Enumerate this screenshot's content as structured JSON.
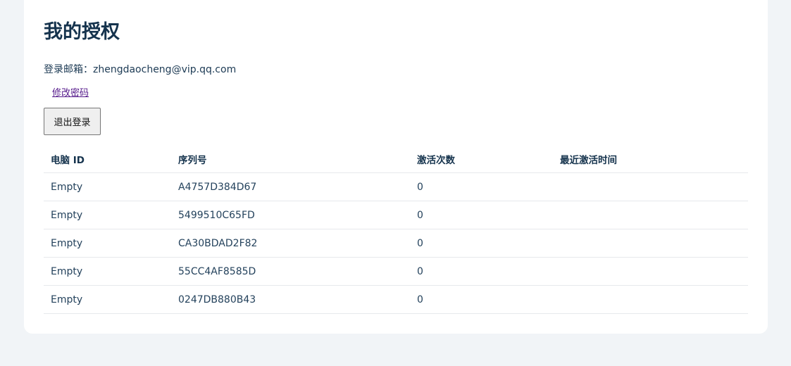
{
  "page": {
    "title": "我的授权",
    "email_label": "登录邮箱：",
    "email_value": "zhengdaocheng@vip.qq.com",
    "change_password_link": "修改密码",
    "logout_button": "退出登录"
  },
  "table": {
    "headers": [
      "电脑 ID",
      "序列号",
      "激活次数",
      "最近激活时间"
    ],
    "rows": [
      {
        "computer_id": "Empty",
        "serial": "A4757D384D67",
        "activations": "0",
        "last_activated": ""
      },
      {
        "computer_id": "Empty",
        "serial": "5499510C65FD",
        "activations": "0",
        "last_activated": ""
      },
      {
        "computer_id": "Empty",
        "serial": "CA30BDAD2F82",
        "activations": "0",
        "last_activated": ""
      },
      {
        "computer_id": "Empty",
        "serial": "55CC4AF8585D",
        "activations": "0",
        "last_activated": ""
      },
      {
        "computer_id": "Empty",
        "serial": "0247DB880B43",
        "activations": "0",
        "last_activated": ""
      }
    ]
  }
}
